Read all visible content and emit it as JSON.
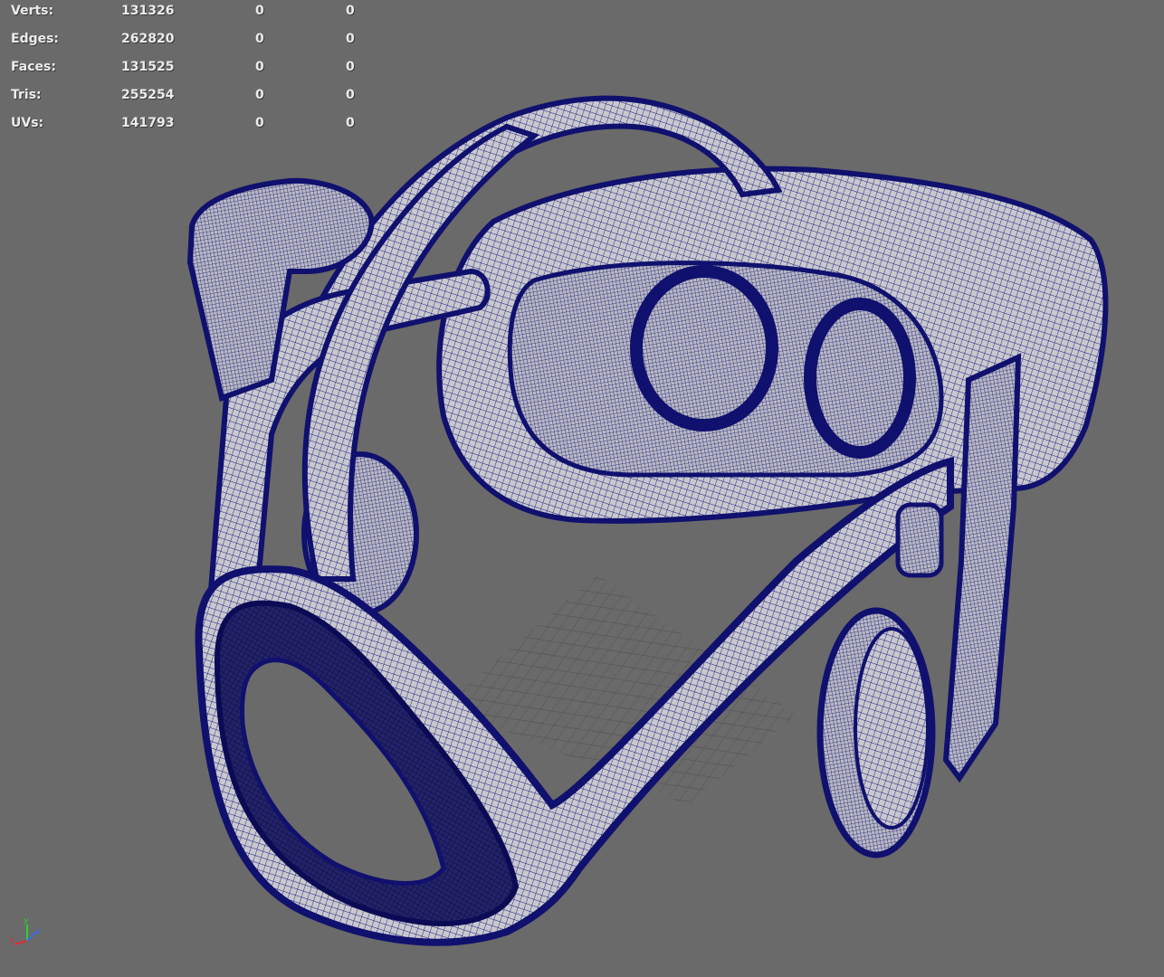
{
  "hud": {
    "rows": [
      {
        "label": "Verts:",
        "total": "131326",
        "selected": "0",
        "triangulated": "0"
      },
      {
        "label": "Edges:",
        "total": "262820",
        "selected": "0",
        "triangulated": "0"
      },
      {
        "label": "Faces:",
        "total": "131525",
        "selected": "0",
        "triangulated": "0"
      },
      {
        "label": "Tris:",
        "total": "255254",
        "selected": "0",
        "triangulated": "0"
      },
      {
        "label": "UVs:",
        "total": "141793",
        "selected": "0",
        "triangulated": "0"
      }
    ]
  },
  "axis_gizmo": {
    "x_label": "x",
    "y_label": "y",
    "z_label": "z"
  },
  "colors": {
    "viewport_bg": "#6a6a6a",
    "wire": "#12127a",
    "surface": "#c9c9cf",
    "grid": "#4e4e4e"
  }
}
